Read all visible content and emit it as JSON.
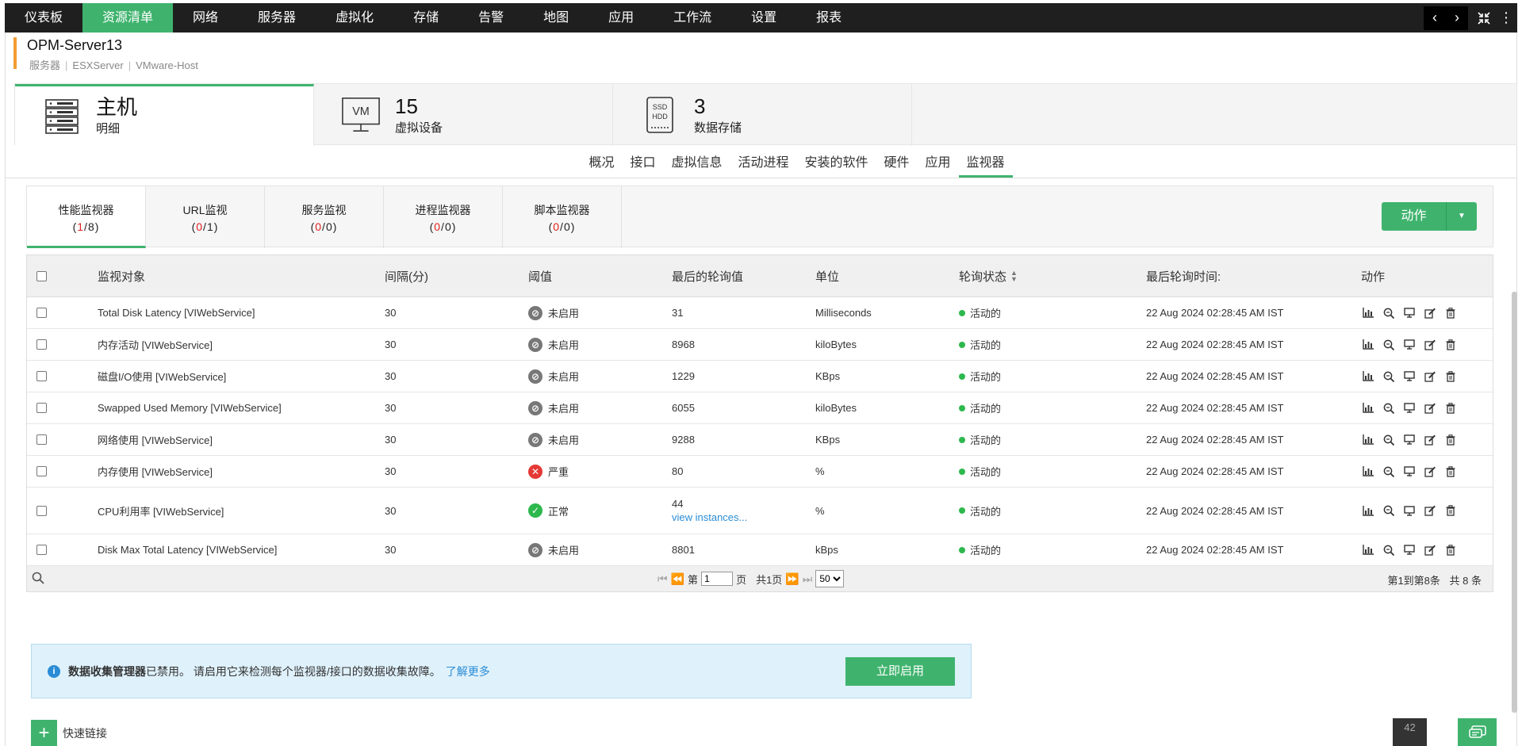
{
  "topnav": {
    "items": [
      "仪表板",
      "资源清单",
      "网络",
      "服务器",
      "虚拟化",
      "存储",
      "告警",
      "地图",
      "应用",
      "工作流",
      "设置",
      "报表"
    ],
    "active_index": 1
  },
  "device": {
    "name": "OPM-Server13",
    "tags": [
      "服务器",
      "ESXServer",
      "VMware-Host"
    ]
  },
  "summary": {
    "host": {
      "title": "主机",
      "sub": "明细"
    },
    "vms": {
      "value": "15",
      "label": "虚拟设备",
      "icon_text": "VM"
    },
    "datastores": {
      "value": "3",
      "label": "数据存储",
      "icon_text_1": "SSD",
      "icon_text_2": "HDD"
    }
  },
  "subtabs": {
    "items": [
      "概况",
      "接口",
      "虚拟信息",
      "活动进程",
      "安装的软件",
      "硬件",
      "应用",
      "监视器"
    ],
    "active_index": 7
  },
  "monitor_tabs": [
    {
      "label": "性能监视器",
      "open": "(",
      "num": "1",
      "sep": "/",
      "total": "8",
      "close": ")"
    },
    {
      "label": "URL监视",
      "open": "(",
      "num": "0",
      "sep": "/",
      "total": "1",
      "close": ")"
    },
    {
      "label": "服务监视",
      "open": "(",
      "num": "0",
      "sep": "/",
      "total": "0",
      "close": ")"
    },
    {
      "label": "进程监视器",
      "open": "(",
      "num": "0",
      "sep": "/",
      "total": "0",
      "close": ")"
    },
    {
      "label": "脚本监视器",
      "open": "(",
      "num": "0",
      "sep": "/",
      "total": "0",
      "close": ")"
    }
  ],
  "action_button": {
    "label": "动作"
  },
  "table": {
    "headers": {
      "object": "监视对象",
      "interval": "间隔(分)",
      "threshold": "阈值",
      "last_value": "最后的轮询值",
      "unit": "单位",
      "status": "轮询状态",
      "last_time": "最后轮询时间:",
      "actions": "动作"
    },
    "rows": [
      {
        "object": "Total Disk Latency [VIWebService]",
        "interval": "30",
        "threshold": "未启用",
        "threshold_state": "disabled",
        "value": "31",
        "value_link": "",
        "unit": "Milliseconds",
        "status": "活动的",
        "time": "22 Aug 2024 02:28:45 AM IST"
      },
      {
        "object": "内存活动 [VIWebService]",
        "interval": "30",
        "threshold": "未启用",
        "threshold_state": "disabled",
        "value": "8968",
        "value_link": "",
        "unit": "kiloBytes",
        "status": "活动的",
        "time": "22 Aug 2024 02:28:45 AM IST"
      },
      {
        "object": "磁盘I/O使用 [VIWebService]",
        "interval": "30",
        "threshold": "未启用",
        "threshold_state": "disabled",
        "value": "1229",
        "value_link": "",
        "unit": "KBps",
        "status": "活动的",
        "time": "22 Aug 2024 02:28:45 AM IST"
      },
      {
        "object": "Swapped Used Memory [VIWebService]",
        "interval": "30",
        "threshold": "未启用",
        "threshold_state": "disabled",
        "value": "6055",
        "value_link": "",
        "unit": "kiloBytes",
        "status": "活动的",
        "time": "22 Aug 2024 02:28:45 AM IST"
      },
      {
        "object": "网络使用 [VIWebService]",
        "interval": "30",
        "threshold": "未启用",
        "threshold_state": "disabled",
        "value": "9288",
        "value_link": "",
        "unit": "KBps",
        "status": "活动的",
        "time": "22 Aug 2024 02:28:45 AM IST"
      },
      {
        "object": "内存使用 [VIWebService]",
        "interval": "30",
        "threshold": "严重",
        "threshold_state": "critical",
        "value": "80",
        "value_link": "",
        "unit": "%",
        "status": "活动的",
        "time": "22 Aug 2024 02:28:45 AM IST"
      },
      {
        "object": "CPU利用率 [VIWebService]",
        "interval": "30",
        "threshold": "正常",
        "threshold_state": "ok",
        "value": "44",
        "value_link": "view instances...",
        "unit": "%",
        "status": "活动的",
        "time": "22 Aug 2024 02:28:45 AM IST"
      },
      {
        "object": "Disk Max Total Latency [VIWebService]",
        "interval": "30",
        "threshold": "未启用",
        "threshold_state": "disabled",
        "value": "8801",
        "value_link": "",
        "unit": "kBps",
        "status": "活动的",
        "time": "22 Aug 2024 02:28:45 AM IST"
      }
    ]
  },
  "pager": {
    "page_prefix": "第",
    "page_value": "1",
    "page_suffix": "页",
    "total_pages": "共1页",
    "page_size": "50",
    "range_text": "第1到第8条",
    "total_text": "共 8 条"
  },
  "banner": {
    "bold": "数据收集管理器",
    "text": "已禁用。 请启用它来检测每个监视器/接口的数据收集故障。",
    "link": "了解更多",
    "button": "立即启用"
  },
  "quick_link": {
    "label": "快速链接"
  },
  "corner_badge": {
    "count": "42"
  },
  "colors": {
    "accent": "#3fb36e",
    "nav_bg": "#1f1f1f",
    "critical": "#e53935",
    "ok": "#2db84d",
    "link": "#2a8cd6"
  }
}
